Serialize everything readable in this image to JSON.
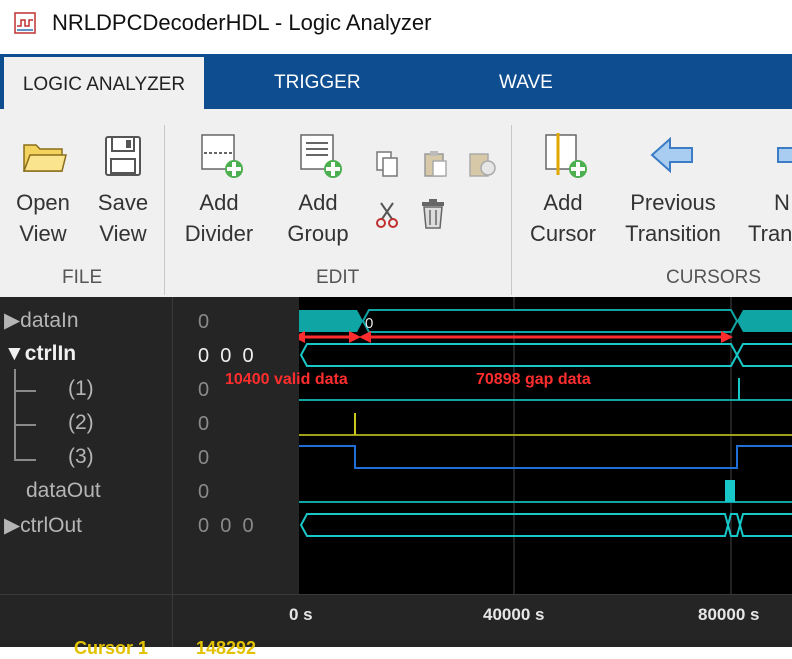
{
  "window": {
    "title": "NRLDPCDecoderHDL - Logic Analyzer"
  },
  "tabs": [
    "LOGIC ANALYZER",
    "TRIGGER",
    "WAVE"
  ],
  "toolstrip": {
    "file": {
      "open_line1": "Open",
      "open_line2": "View",
      "save_line1": "Save",
      "save_line2": "View",
      "section": "FILE"
    },
    "edit": {
      "divider_line1": "Add",
      "divider_line2": "Divider",
      "group_line1": "Add",
      "group_line2": "Group",
      "section": "EDIT"
    },
    "cursors": {
      "cursor_line1": "Add",
      "cursor_line2": "Cursor",
      "prev_line1": "Previous",
      "prev_line2": "Transition",
      "next_line1": "N",
      "next_line2": "Tran",
      "section": "CURSORS"
    }
  },
  "signals": [
    {
      "name": "dataIn",
      "value": "0"
    },
    {
      "name": "ctrlIn",
      "value": "0  0  0"
    },
    {
      "name": "(1)",
      "value": "0"
    },
    {
      "name": "(2)",
      "value": "0"
    },
    {
      "name": "(3)",
      "value": "0"
    },
    {
      "name": "dataOut",
      "value": "0"
    },
    {
      "name": "ctrlOut",
      "value": "0  0  0"
    }
  ],
  "expand_glyphs": {
    "collapsed": "▶",
    "expanded": "▼"
  },
  "bus_label": "0",
  "annotations": {
    "valid": "10400 valid data",
    "gap": "70898 gap data"
  },
  "axis": {
    "ticks": [
      "0 s",
      "40000 s",
      "80000 s"
    ]
  },
  "cursor": {
    "name": "Cursor 1",
    "value": "148292"
  },
  "colors": {
    "tab_bar": "#0e4d8f",
    "wave_cyan": "#18c8c8",
    "bus_teal": "#0fa5a5",
    "olive": "#a0a018",
    "blue": "#1f6fd6",
    "annotation_red": "#ff2d2d",
    "cursor_yellow": "#e2c200"
  }
}
